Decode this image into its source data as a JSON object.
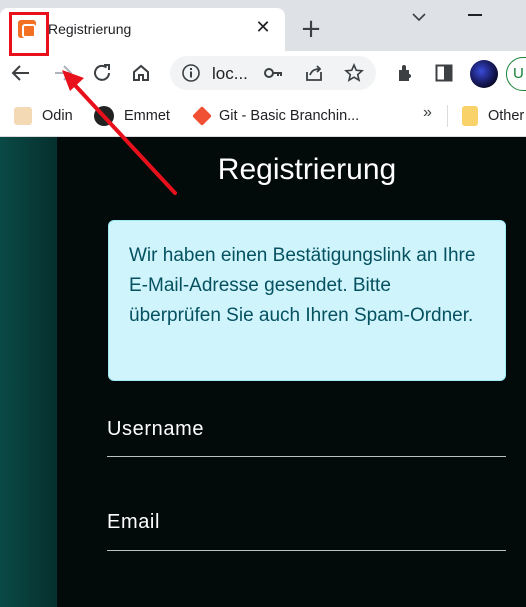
{
  "browser": {
    "tab": {
      "title": "Registrierung",
      "close_glyph": "✕",
      "favicon": "xampp-icon"
    },
    "new_tab_glyph": "+",
    "omnibox": {
      "text": "loc..."
    },
    "profile_pill_text": "U",
    "bookmarks": [
      {
        "label": "Odin",
        "icon": "odin-icon"
      },
      {
        "label": "Emmet",
        "icon": "emmet-icon"
      },
      {
        "label": "Git - Basic Branchin...",
        "icon": "git-icon"
      },
      {
        "label": "Other",
        "icon": "folder-icon"
      }
    ],
    "bookmarks_overflow": "»"
  },
  "page": {
    "title": "Registrierung",
    "alert_text": "Wir haben einen Bestätigungslink an Ihre E-Mail-Adresse gesendet. Bitte überprüfen Sie auch Ihren Spam-Ordner.",
    "fields": [
      {
        "label": "Username"
      },
      {
        "label": "Email"
      }
    ]
  },
  "colors": {
    "annotation_red": "#e8101b",
    "page_background": "#020a0a",
    "alert_background": "#cff4fc",
    "alert_text": "#055160"
  }
}
